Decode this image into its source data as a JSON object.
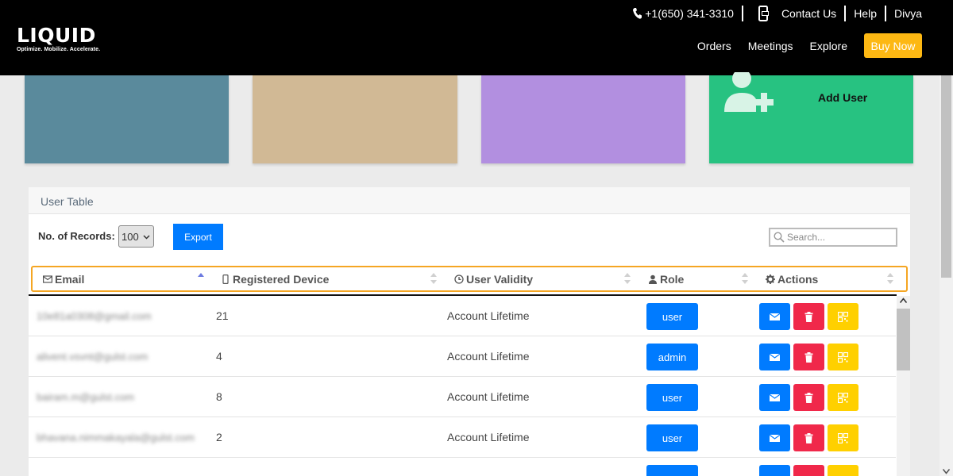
{
  "header": {
    "logo_text": "LIQUID",
    "tagline": "Optimize. Mobilize. Accelerate.",
    "phone": "+1(650) 341-3310",
    "contact_label": "Contact Us",
    "help_label": "Help",
    "user_name": "Divya",
    "nav": [
      "Orders",
      "Meetings",
      "Explore"
    ],
    "buy_label": "Buy Now"
  },
  "cards": {
    "add_user_label": "Add User"
  },
  "panel": {
    "title": "User Table",
    "records_label": "No. of Records:",
    "records_value": "100",
    "export_label": "Export",
    "search_placeholder": "Search..."
  },
  "table": {
    "columns": {
      "email": "Email",
      "device": "Registered Device",
      "validity": "User Validity",
      "role": "Role",
      "actions": "Actions"
    },
    "rows": [
      {
        "email": "10e81a0308@gmail.com",
        "device": "21",
        "validity": "Account Lifetime",
        "role": "user"
      },
      {
        "email": "alivent.vsvnt@gulst.com",
        "device": "4",
        "validity": "Account Lifetime",
        "role": "admin"
      },
      {
        "email": "bairam.m@gulst.com",
        "device": "8",
        "validity": "Account Lifetime",
        "role": "user"
      },
      {
        "email": "bhavana.nimmakayala@gulst.com",
        "device": "2",
        "validity": "Account Lifetime",
        "role": "user"
      },
      {
        "email": "",
        "device": "",
        "validity": "",
        "role": ""
      }
    ]
  },
  "colors": {
    "header_bg": "#000000",
    "buy_now": "#fdb813",
    "card_blue": "#5a8a9c",
    "card_tan": "#d1b995",
    "card_purple": "#b28fe0",
    "card_green": "#27c281",
    "primary": "#007bff",
    "danger": "#f0284a",
    "warning": "#ffd000",
    "highlight_border": "#f5a623"
  },
  "icons": {
    "phone": "phone-icon",
    "contact": "mobile-device-icon",
    "add_user": "add-user-icon",
    "email_col": "envelope-icon",
    "device_col": "mobile-icon",
    "validity_col": "clock-icon",
    "role_col": "user-icon",
    "actions_col": "gear-icon",
    "row_mail": "envelope-icon",
    "row_delete": "trash-icon",
    "row_qr": "qr-code-icon",
    "search": "search-icon"
  }
}
